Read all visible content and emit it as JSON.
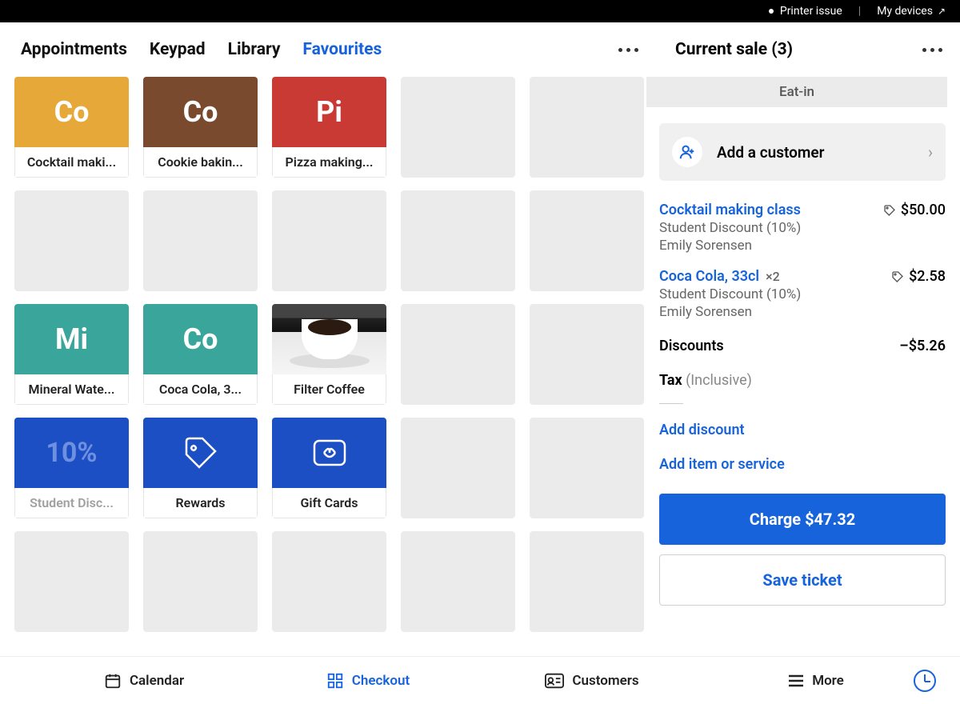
{
  "topbar": {
    "printer": "Printer issue",
    "devices": "My devices"
  },
  "tabs": [
    "Appointments",
    "Keypad",
    "Library",
    "Favourites"
  ],
  "activeTab": 3,
  "tiles": {
    "row0": [
      {
        "type": "item",
        "bg": "#e7a83a",
        "abbr": "Co",
        "label": "Cocktail maki..."
      },
      {
        "type": "item",
        "bg": "#7a4a2f",
        "abbr": "Co",
        "label": "Cookie bakin..."
      },
      {
        "type": "item",
        "bg": "#c93a34",
        "abbr": "Pi",
        "label": "Pizza making..."
      },
      {
        "type": "empty"
      },
      {
        "type": "empty"
      }
    ],
    "row1": [
      {
        "type": "empty"
      },
      {
        "type": "empty"
      },
      {
        "type": "empty"
      },
      {
        "type": "empty"
      },
      {
        "type": "empty"
      }
    ],
    "row2": [
      {
        "type": "item",
        "bg": "#3aa59b",
        "abbr": "Mi",
        "label": "Mineral Wate..."
      },
      {
        "type": "item",
        "bg": "#3aa59b",
        "abbr": "Co",
        "label": "Coca Cola, 3..."
      },
      {
        "type": "coffee",
        "label": "Filter Coffee"
      },
      {
        "type": "empty"
      },
      {
        "type": "empty"
      }
    ],
    "row3": [
      {
        "type": "discount",
        "bg": "#1c4fc4",
        "text": "10%",
        "label": "Student Disc...",
        "muted": true
      },
      {
        "type": "rewards",
        "bg": "#1c4fc4",
        "label": "Rewards"
      },
      {
        "type": "giftcards",
        "bg": "#1c4fc4",
        "label": "Gift Cards"
      },
      {
        "type": "empty"
      },
      {
        "type": "empty"
      }
    ],
    "row4": [
      {
        "type": "empty"
      },
      {
        "type": "empty"
      },
      {
        "type": "empty"
      },
      {
        "type": "empty"
      },
      {
        "type": "empty"
      }
    ]
  },
  "sale": {
    "title": "Current sale (3)",
    "mode": "Eat-in",
    "addCustomer": "Add a customer",
    "items": [
      {
        "name": "Cocktail making class",
        "qty": "",
        "price": "$50.00",
        "discount": "Student Discount (10%)",
        "staff": "Emily Sorensen"
      },
      {
        "name": "Coca Cola, 33cl",
        "qty": "×2",
        "price": "$2.58",
        "discount": "Student Discount (10%)",
        "staff": "Emily Sorensen"
      }
    ],
    "discountsLabel": "Discounts",
    "discountsValue": "–$5.26",
    "taxLabel": "Tax",
    "taxNote": "(Inclusive)",
    "addDiscount": "Add discount",
    "addItem": "Add item or service",
    "chargeLabel": "Charge $47.32",
    "saveLabel": "Save ticket"
  },
  "bottomnav": {
    "items": [
      "Calendar",
      "Checkout",
      "Customers",
      "More"
    ],
    "active": 1
  }
}
